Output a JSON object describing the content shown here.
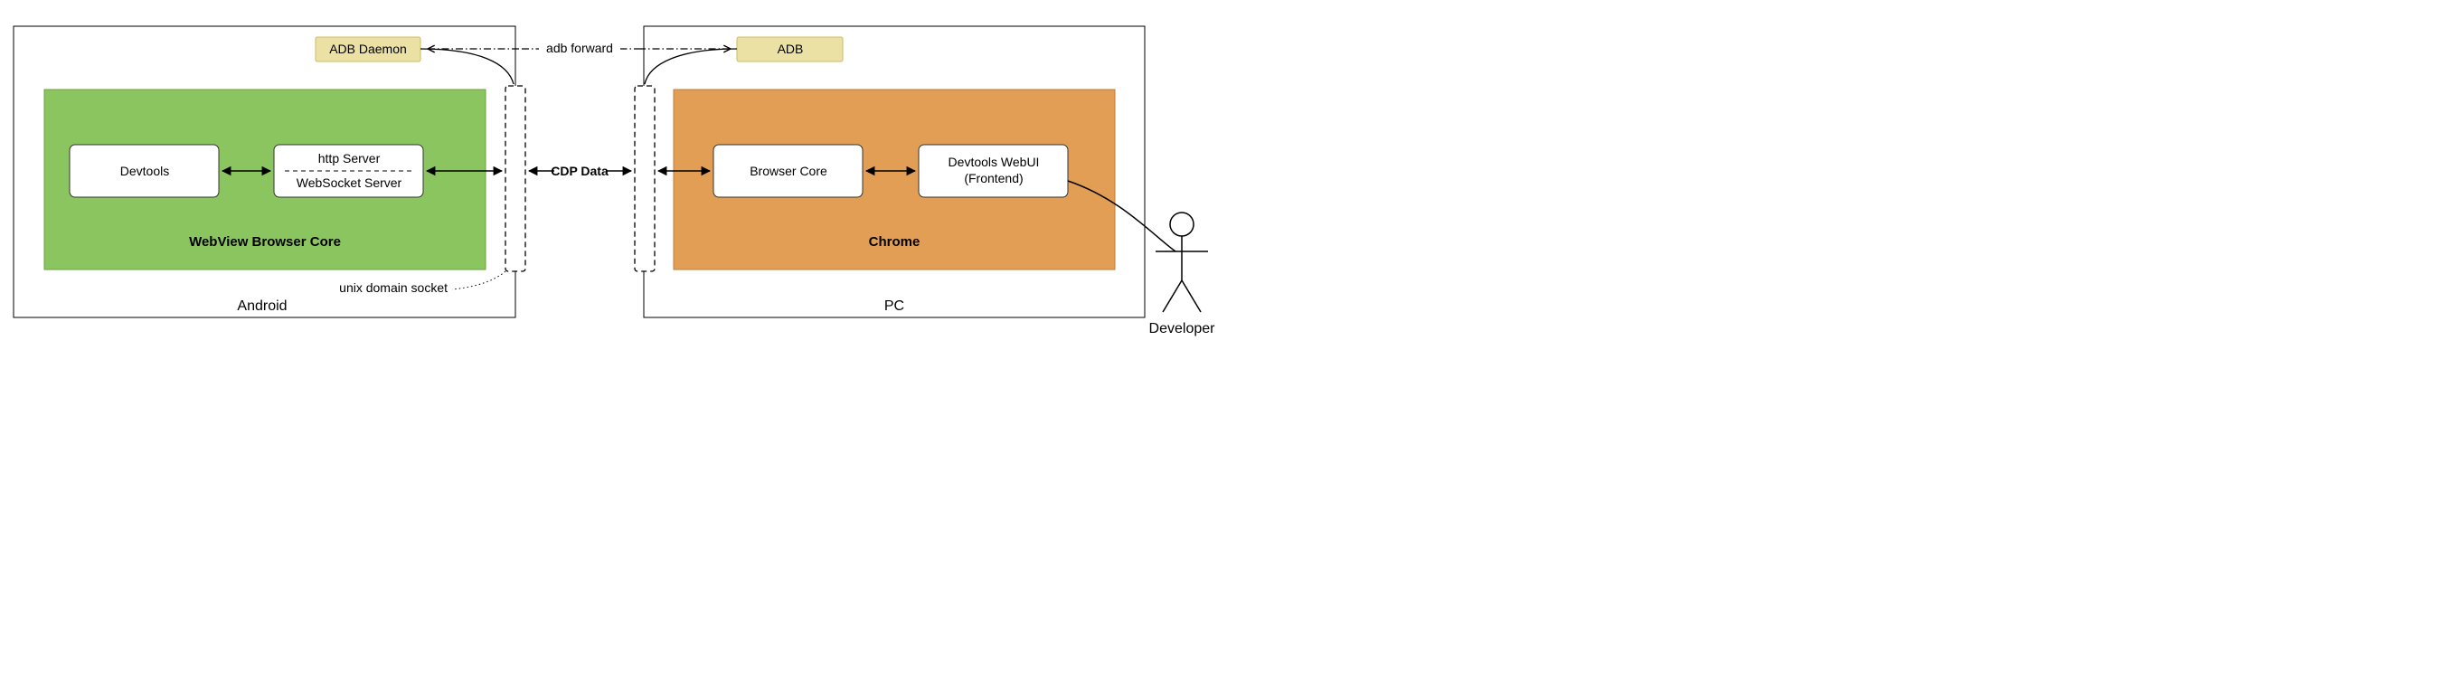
{
  "android": {
    "title": "Android",
    "adb_daemon": "ADB Daemon",
    "webview_core_title": "WebView Browser Core",
    "devtools": "Devtools",
    "http_server": "http Server",
    "ws_server": "WebSocket Server",
    "unix_socket_label": "unix domain socket"
  },
  "pc": {
    "title": "PC",
    "adb": "ADB",
    "chrome_title": "Chrome",
    "browser_core": "Browser Core",
    "devtools_webui_line1": "Devtools WebUI",
    "devtools_webui_line2": "(Frontend)"
  },
  "middle": {
    "adb_forward": "adb forward",
    "cdp_data": "CDP Data"
  },
  "developer": {
    "label": "Developer"
  },
  "colors": {
    "android_green": "#8bc560",
    "pc_orange": "#e39e55",
    "adb_yellow": "#ece1a5",
    "adb_border": "#cdbd5c",
    "box_border": "#333333"
  }
}
